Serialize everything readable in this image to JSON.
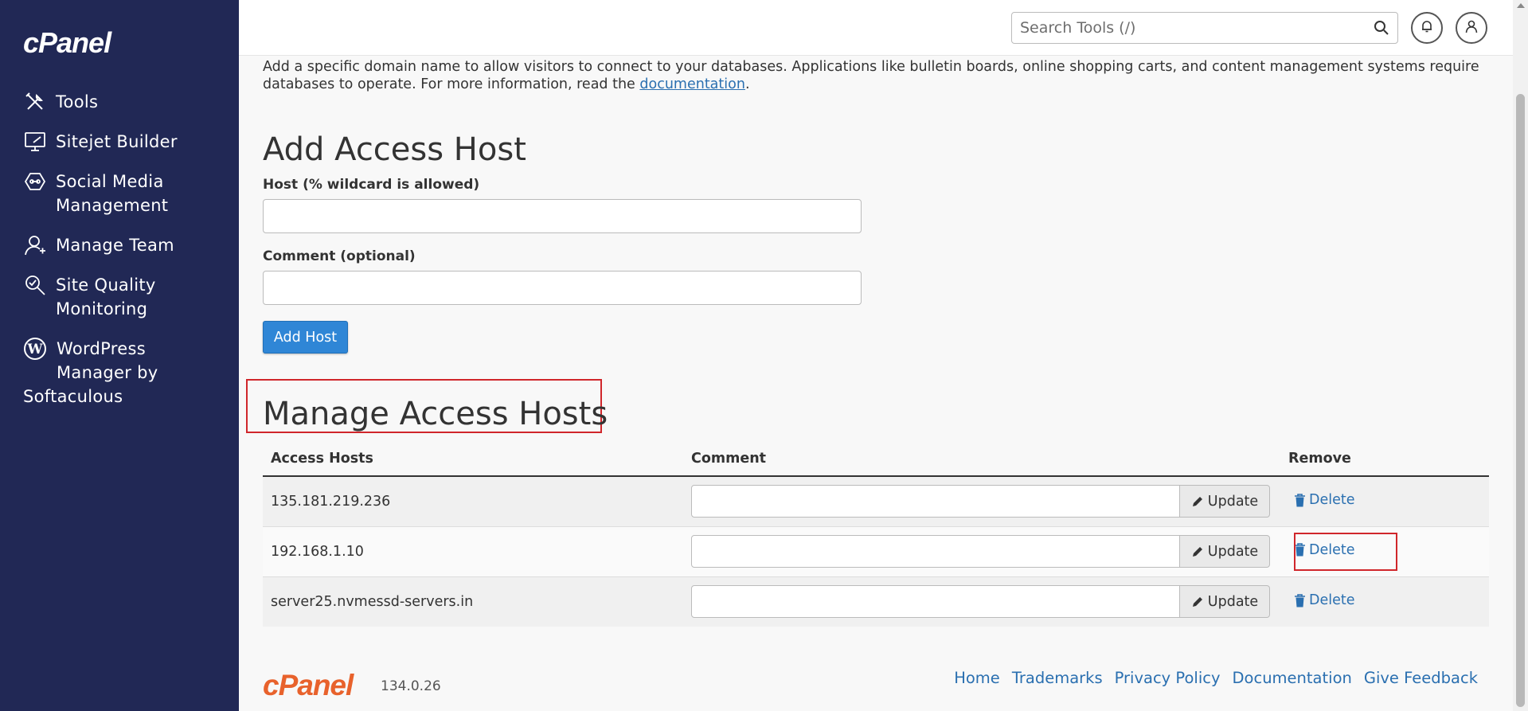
{
  "sidebar": {
    "logo": "cPanel",
    "items": [
      {
        "label": "Tools",
        "icon": "tools-icon"
      },
      {
        "label": "Sitejet Builder",
        "icon": "monitor-icon"
      },
      {
        "label": "Social Media",
        "label2": "Management",
        "icon": "social-icon"
      },
      {
        "label": "Manage Team",
        "icon": "team-icon"
      },
      {
        "label": "Site Quality",
        "label2": "Monitoring",
        "icon": "search-quality-icon"
      },
      {
        "label": "WordPress",
        "label2": "Manager by",
        "label3": "Softaculous",
        "icon": "wordpress-icon"
      }
    ]
  },
  "header": {
    "search_placeholder": "Search Tools (/)",
    "icons": [
      "search-icon",
      "bell-icon",
      "user-icon"
    ]
  },
  "intro": {
    "text": "Add a specific domain name to allow visitors to connect to your databases. Applications like bulletin boards, online shopping carts, and content management systems require databases to operate. For more information, read the ",
    "link": "documentation",
    "end": "."
  },
  "add_form": {
    "title": "Add Access Host",
    "host_label": "Host (% wildcard is allowed)",
    "host_value": "",
    "comment_label": "Comment (optional)",
    "comment_value": "",
    "submit_label": "Add Host"
  },
  "manage": {
    "title": "Manage Access Hosts",
    "columns": [
      "Access Hosts",
      "Comment",
      "Remove"
    ],
    "rows": [
      {
        "host": "135.181.219.236",
        "comment": "",
        "update": "Update",
        "delete": "Delete"
      },
      {
        "host": "192.168.1.10",
        "comment": "",
        "update": "Update",
        "delete": "Delete"
      },
      {
        "host": "server25.nvmessd-servers.in",
        "comment": "",
        "update": "Update",
        "delete": "Delete"
      }
    ]
  },
  "footer": {
    "logo": "cPanel",
    "version": "134.0.26",
    "links": [
      "Home",
      "Trademarks",
      "Privacy Policy",
      "Documentation",
      "Give Feedback"
    ]
  },
  "colors": {
    "sidebar_bg": "#212855",
    "primary": "#2f86d6",
    "link": "#2a6fb0",
    "highlight": "#d0262b",
    "footer_logo": "#e8622c"
  }
}
